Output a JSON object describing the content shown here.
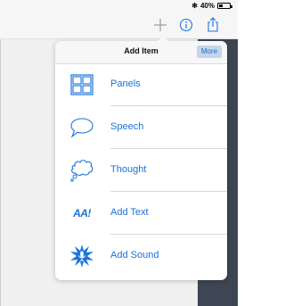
{
  "status_bar": {
    "bluetooth": "✻",
    "battery_percent": "40%",
    "battery_level": 0.4
  },
  "toolbar": {
    "add_icon": "plus-icon",
    "info_icon": "info-icon",
    "share_icon": "share-icon"
  },
  "colors": {
    "accent": "#1a73d9",
    "canvas": "#3d4652",
    "more_bg": "#c6d6ea"
  },
  "popover": {
    "title": "Add Item",
    "more_label": "More",
    "items": [
      {
        "label": "Panels",
        "icon": "panels-icon"
      },
      {
        "label": "Speech",
        "icon": "speech-bubble-icon"
      },
      {
        "label": "Thought",
        "icon": "thought-bubble-icon"
      },
      {
        "label": "Add Text",
        "icon": "text-icon",
        "icon_text": "AA!"
      },
      {
        "label": "Add Sound",
        "icon": "sound-burst-icon"
      }
    ]
  }
}
